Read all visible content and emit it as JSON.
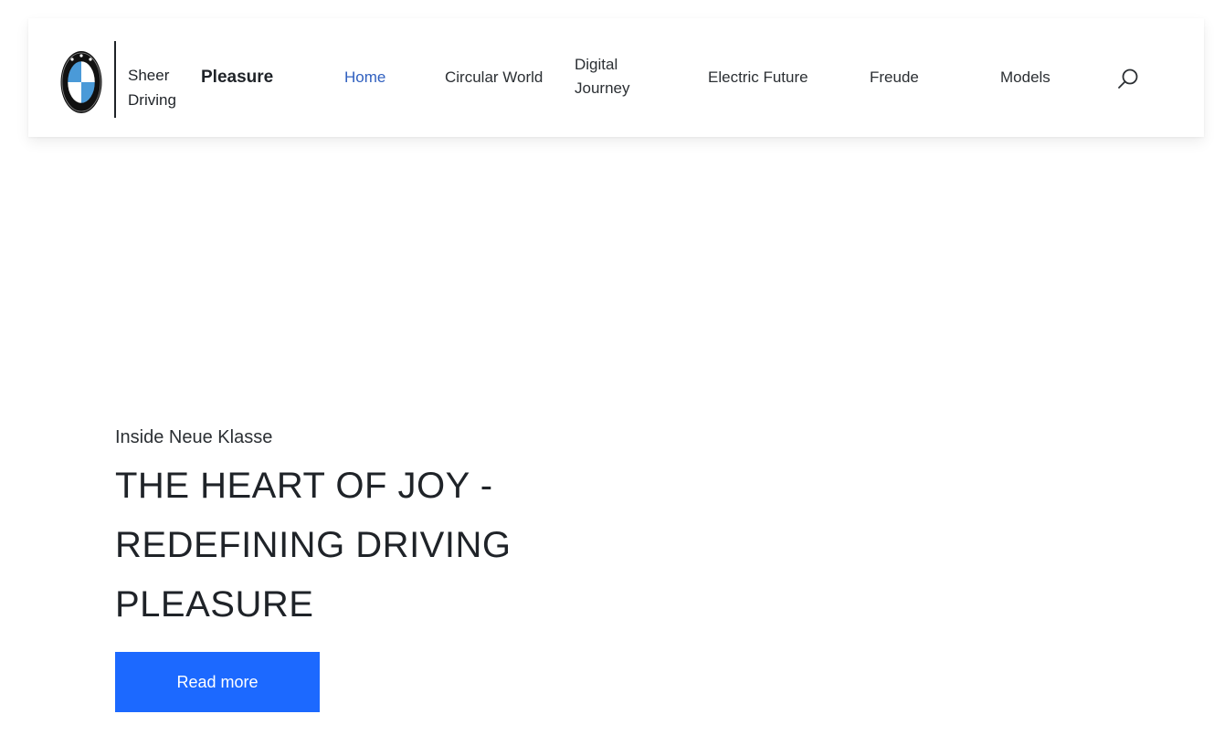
{
  "header": {
    "logo_icon": "bmw-roundel-icon",
    "logo_lettering": "BMW",
    "brand_tagline": "Sheer Driving",
    "brand_name": "Pleasure",
    "nav": [
      {
        "label": "Home",
        "active": true
      },
      {
        "label": "Circular World",
        "active": false
      },
      {
        "label": "Digital Journey",
        "active": false
      },
      {
        "label": "Electric Future",
        "active": false
      },
      {
        "label": "Freude",
        "active": false
      },
      {
        "label": "Models",
        "active": false
      }
    ],
    "search_icon": "search-icon"
  },
  "hero": {
    "eyebrow": "Inside Neue Klasse",
    "title": "THE HEART OF JOY - REDEFINING DRIVING PLEASURE",
    "cta_label": "Read more"
  },
  "colors": {
    "accent": "#1c69ff",
    "active_nav": "#2f5fbf",
    "text": "#1f2328"
  }
}
